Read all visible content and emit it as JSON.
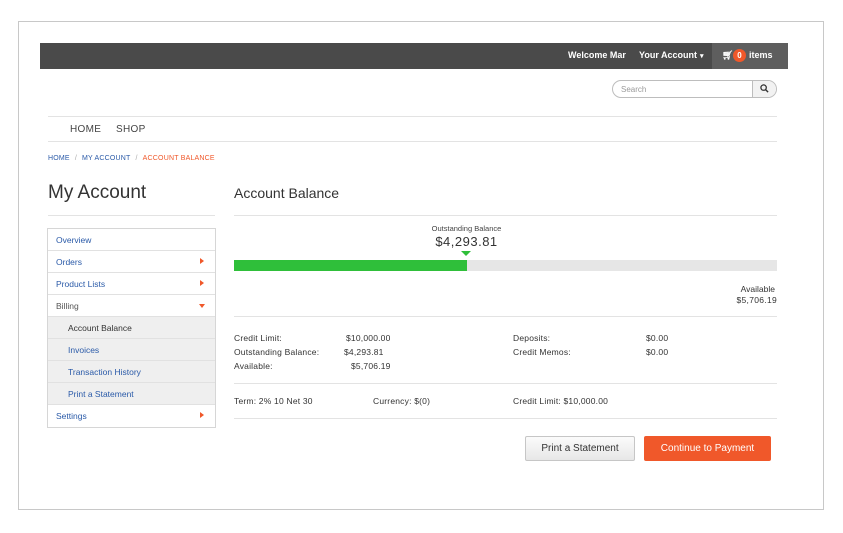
{
  "topbar": {
    "welcome": "Welcome Mar",
    "account_menu": "Your Account",
    "cart_count": "0",
    "cart_label": "items"
  },
  "search": {
    "placeholder": "Search"
  },
  "nav": {
    "items": [
      "HOME",
      "SHOP"
    ]
  },
  "breadcrumb": {
    "items": [
      "HOME",
      "MY ACCOUNT"
    ],
    "separator": "/",
    "current": "ACCOUNT BALANCE"
  },
  "page_title": "My Account",
  "section_title": "Account Balance",
  "sidebar": {
    "items": [
      {
        "label": "Overview"
      },
      {
        "label": "Orders"
      },
      {
        "label": "Product Lists"
      },
      {
        "label": "Billing"
      },
      {
        "label": "Account Balance"
      },
      {
        "label": "Invoices"
      },
      {
        "label": "Transaction History"
      },
      {
        "label": "Print a Statement"
      },
      {
        "label": "Settings"
      }
    ]
  },
  "balance": {
    "outstanding_label": "Outstanding Balance",
    "outstanding_value": "$4,293.81",
    "available_label": "Available",
    "available_value": "$5,706.19",
    "fill_fraction": 0.4294
  },
  "details": {
    "credit_limit_label": "Credit Limit:",
    "credit_limit_value": "$10,000.00",
    "outstanding_label": "Outstanding Balance:",
    "outstanding_value": "$4,293.81",
    "available_label": "Available:",
    "available_value": "$5,706.19",
    "deposits_label": "Deposits:",
    "deposits_value": "$0.00",
    "credit_memos_label": "Credit Memos:",
    "credit_memos_value": "$0.00"
  },
  "terms": {
    "term": "Term: 2% 10 Net 30",
    "currency": "Currency: $(0)",
    "credit_limit": "Credit Limit: $10,000.00"
  },
  "actions": {
    "print_statement": "Print a Statement",
    "continue_payment": "Continue to Payment"
  },
  "colors": {
    "accent": "#f0582a",
    "link": "#2a5aa8",
    "bar_fill": "#2fbf3a",
    "topbar": "#4a4a4a"
  }
}
